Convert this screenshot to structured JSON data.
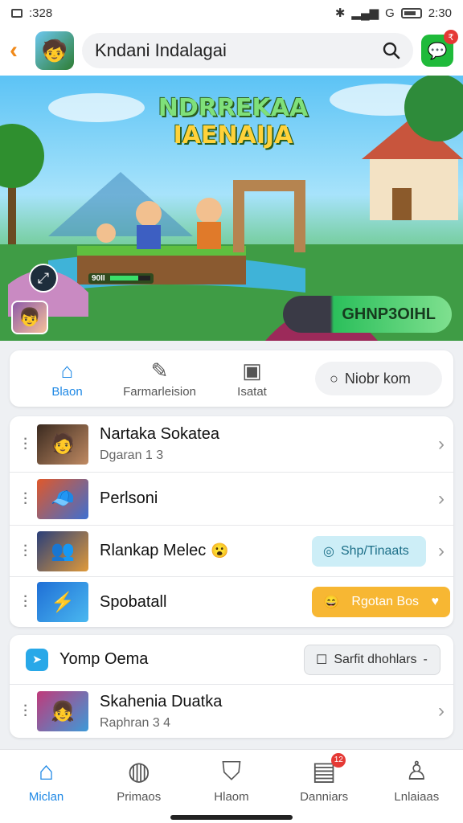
{
  "status_bar": {
    "time_left": ":328",
    "time_right": "2:30",
    "carrier_glyph": "G"
  },
  "header": {
    "search_text": "Kndani Indalagai",
    "chat_badge": "₹"
  },
  "banner": {
    "title_line1": "NDRREKAA",
    "title_line2": "IAENAIJA",
    "progress_label": "90II",
    "progress_fraction": 0.7,
    "play_label": "GHNP3OIHL"
  },
  "tabs": [
    {
      "label": "Blaon",
      "icon": "home-icon"
    },
    {
      "label": "Farmarleision",
      "icon": "edit-icon"
    },
    {
      "label": "Isatat",
      "icon": "bookmark-icon"
    }
  ],
  "tab_search_label": "Niobr kom",
  "list1": [
    {
      "title": "Nartaka Sokatea",
      "subtitle": "Dgaran 1 3"
    },
    {
      "title": "Perlsoni",
      "subtitle": ""
    },
    {
      "title": "Rlankap Melec",
      "subtitle": "",
      "emoji": "😮",
      "pill": "Shp/Tinaats"
    },
    {
      "title": "Spobatall",
      "subtitle": "",
      "pill": "Rgotan Bos"
    }
  ],
  "section2": {
    "title": "Yomp Oema",
    "pill": "Sarfit dhohlars",
    "pill_suffix": "-"
  },
  "list2": [
    {
      "title": "Skahenia Duatka",
      "subtitle": "Raphran 3 4"
    }
  ],
  "bottom_nav": [
    {
      "label": "Miclan",
      "icon": "home-icon",
      "active": true
    },
    {
      "label": "Primaos",
      "icon": "compass-icon"
    },
    {
      "label": "Hlaom",
      "icon": "shield-icon"
    },
    {
      "label": "Danniars",
      "icon": "clipboard-icon",
      "badge": "12"
    },
    {
      "label": "Lnlaiaas",
      "icon": "person-icon"
    }
  ],
  "colors": {
    "accent": "#1e88e5",
    "back_arrow": "#f08a1a",
    "chat_green": "#1fba3a",
    "badge_red": "#e53935",
    "pill_orange": "#f7b733"
  }
}
